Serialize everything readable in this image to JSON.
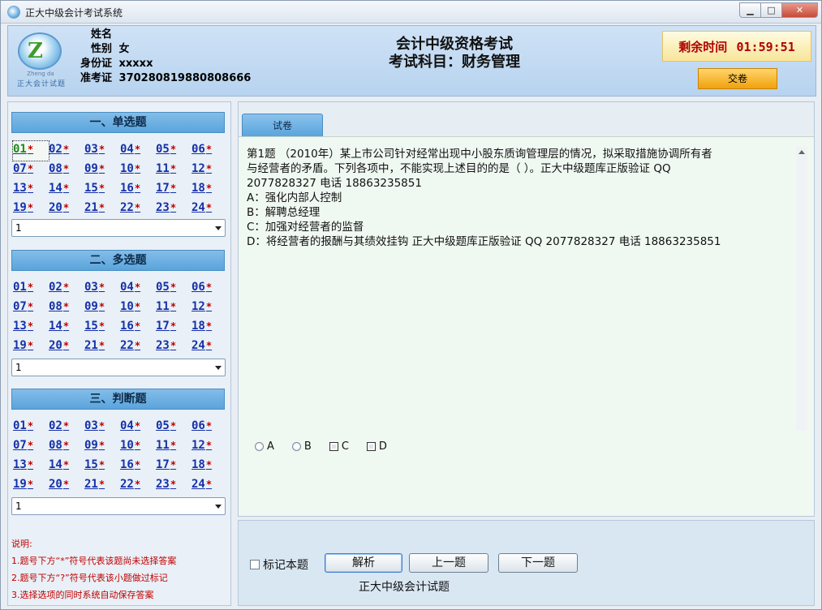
{
  "window": {
    "title": "正大中级会计考试系统",
    "minimize_icon": "minimize-icon",
    "maximize_icon": "maximize-icon",
    "close_icon": "close-icon"
  },
  "header": {
    "logo_small": "Zheng da",
    "logo_text": "正大会计试题",
    "candidate": {
      "name_label": "姓名",
      "name_value": "",
      "gender_label": "性别",
      "gender_value": "女",
      "id_label": "身份证",
      "id_value": "xxxxx",
      "ticket_label": "准考证",
      "ticket_value": "370280819880808666"
    },
    "exam_title": "会计中级资格考试",
    "exam_subject": "考试科目：财务管理",
    "timer_label": "剩余时间",
    "timer_value": "01:59:51",
    "submit_label": "交卷"
  },
  "left_panel": {
    "sections": [
      {
        "title": "一、单选题",
        "questions": [
          "01",
          "02",
          "03",
          "04",
          "05",
          "06",
          "07",
          "08",
          "09",
          "10",
          "11",
          "12",
          "13",
          "14",
          "15",
          "16",
          "17",
          "18",
          "19",
          "20",
          "21",
          "22",
          "23",
          "24"
        ],
        "current": "01",
        "page_select": "1"
      },
      {
        "title": "二、多选题",
        "questions": [
          "01",
          "02",
          "03",
          "04",
          "05",
          "06",
          "07",
          "08",
          "09",
          "10",
          "11",
          "12",
          "13",
          "14",
          "15",
          "16",
          "17",
          "18",
          "19",
          "20",
          "21",
          "22",
          "23",
          "24"
        ],
        "current": "",
        "page_select": "1"
      },
      {
        "title": "三、判断题",
        "questions": [
          "01",
          "02",
          "03",
          "04",
          "05",
          "06",
          "07",
          "08",
          "09",
          "10",
          "11",
          "12",
          "13",
          "14",
          "15",
          "16",
          "17",
          "18",
          "19",
          "20",
          "21",
          "22",
          "23",
          "24"
        ],
        "current": "",
        "page_select": "1"
      }
    ],
    "star": "*",
    "notes": [
      "说明:",
      "1.题号下方“*”符号代表该题尚未选择答案",
      "2.题号下方“?”符号代表该小题做过标记",
      "3.选择选项的同时系统自动保存答案"
    ]
  },
  "main": {
    "tab_label": "试卷",
    "question_lines": [
      "第1题 （2010年）某上市公司针对经常出现中小股东质询管理层的情况，拟采取措施协调所有者",
      "与经营者的矛盾。下列各项中，不能实现上述目的的是（ ）。正大中级题库正版验证 QQ",
      "2077828327 电话 18863235851",
      "A：强化内部人控制",
      "B：解聘总经理",
      "C：加强对经营者的监督",
      "D：将经营者的报酬与其绩效挂钩 正大中级题库正版验证 QQ 2077828327 电话 18863235851"
    ],
    "options": [
      "A",
      "B",
      "C",
      "D"
    ],
    "option_types": [
      "radio",
      "radio",
      "checkbox",
      "checkbox"
    ]
  },
  "bottom": {
    "mark_label": "标记本题",
    "analysis_label": "解析",
    "prev_label": "上一题",
    "next_label": "下一题",
    "footer_text": "正大中级会计试题"
  }
}
